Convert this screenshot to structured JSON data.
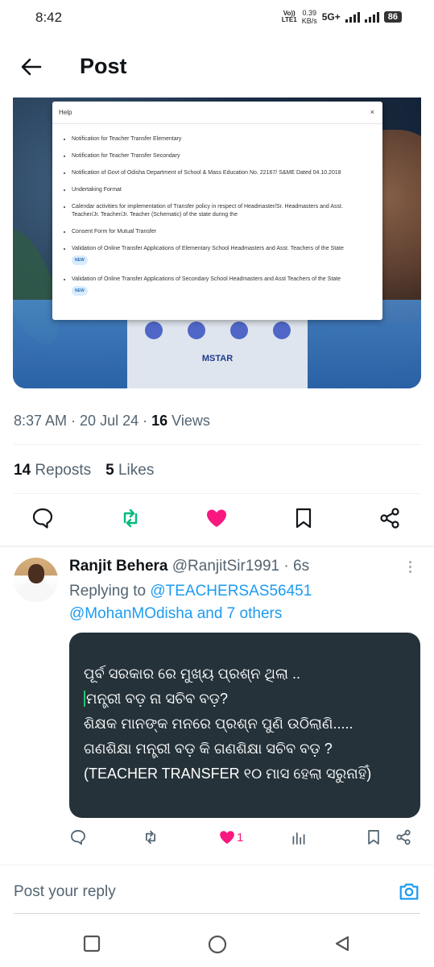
{
  "status_bar": {
    "time": "8:42",
    "volte_top": "Vo))",
    "volte_bottom": "LTE1",
    "speed_value": "0.39",
    "speed_unit": "KB/s",
    "network": "5G+",
    "battery": "86"
  },
  "header": {
    "title": "Post"
  },
  "media": {
    "help_title": "Help",
    "close_symbol": "×",
    "new_badge": "NEW",
    "items": [
      "Notification for Teacher Transfer Elementary",
      "Notification for Teacher Transfer Secondary",
      "Notification of Govt of Odisha Department of School & Mass Education No. 22167/ S&ME Dated 04.10.2018",
      "Undertaking Format",
      "Calendar activities for implementation of Transfer policy in respect of Headmaster/Sr. Headmasters and Asst. Teacher/Jr. Teacher/Jr. Teacher (Schematic) of the state during the",
      "Consent Form for Mutual Transfer",
      "Validation of Online Transfer Applications of Elementary School Headmasters and Asst. Teachers of the State",
      "Validation of Online Transfer Applications of Secondary School Headmasters and Asst Teachers of the State"
    ],
    "brand": "MSTAR"
  },
  "post_meta": {
    "time": "8:37 AM",
    "date": "20 Jul 24",
    "views_count": "16",
    "views_label": "Views"
  },
  "stats": {
    "reposts_count": "14",
    "reposts_label": "Reposts",
    "likes_count": "5",
    "likes_label": "Likes"
  },
  "reply": {
    "name": "Ranjit Behera",
    "handle": "@RanjitSir1991",
    "age": "· 6s",
    "replying_prefix": "Replying to",
    "replying_user1": "@TEACHERSAS56451",
    "replying_user2": "@MohanMOdisha",
    "replying_suffix": "and 7 others",
    "text_lines": [
      "ପୂର୍ବ ସରକାର ରେ ମୁଖ୍ୟ ପ୍ରଶ୍ନ ଥିଲା ..",
      "ମନ୍ତ୍ରୀ ବଡ଼ ନା ସଚିବ ବଡ଼?",
      "ଶିକ୍ଷକ ମାନଙ୍କ ମନରେ ପ୍ରଶ୍ନ ପୁଣି ଉଠିଲାଣି.....",
      "ଗଣଶିକ୍ଷା ମନ୍ତ୍ରୀ ବଡ଼ କି ଗଣଶିକ୍ଷା ସଚିବ ବଡ଼ ?",
      "(TEACHER TRANSFER ୧୦ ମାସ ହେଲା ସରୁନାହିଁ)"
    ],
    "like_count": "1"
  },
  "composer": {
    "placeholder": "Post your reply"
  },
  "colors": {
    "accent": "#1d9bf0",
    "like": "#f91880",
    "repost": "#00ba7c",
    "bubble": "#253239"
  }
}
